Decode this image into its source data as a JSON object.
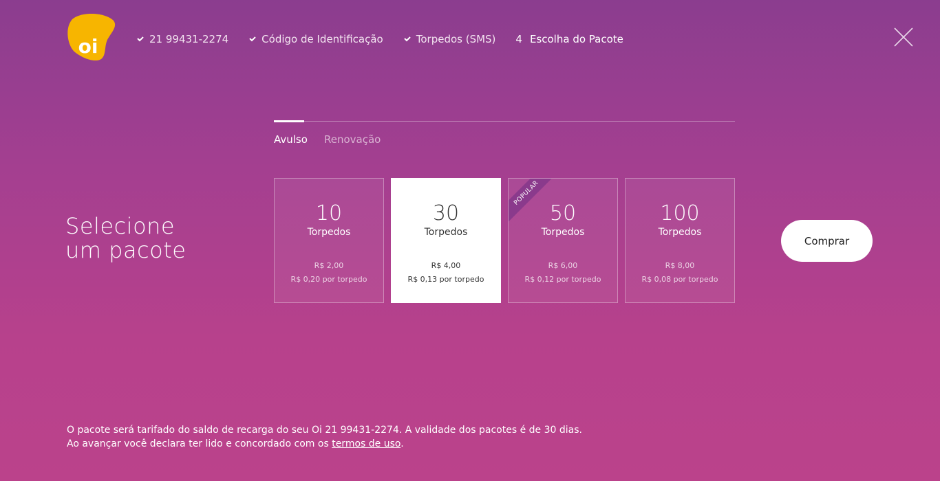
{
  "brand": {
    "logo_text": "oi",
    "logo_color": "#f7b500"
  },
  "steps": [
    {
      "label": "21 99431-2274",
      "done": true
    },
    {
      "label": "Código de Identificação",
      "done": true
    },
    {
      "label": "Torpedos (SMS)",
      "done": true
    },
    {
      "number": "4",
      "label": "Escolha do Pacote",
      "done": false
    }
  ],
  "tabs": [
    {
      "label": "Avulso",
      "active": true
    },
    {
      "label": "Renovação",
      "active": false
    }
  ],
  "headline": {
    "line1": "Selecione",
    "line2": "um pacote"
  },
  "packages": [
    {
      "qty": "10",
      "unit": "Torpedos",
      "price": "R$ 2,00",
      "per": "R$ 0,20 por torpedo",
      "selected": false
    },
    {
      "qty": "30",
      "unit": "Torpedos",
      "price": "R$ 4,00",
      "per": "R$ 0,13 por torpedo",
      "selected": true
    },
    {
      "qty": "50",
      "unit": "Torpedos",
      "price": "R$ 6,00",
      "per": "R$ 0,12 por torpedo",
      "selected": false,
      "badge": "Popular"
    },
    {
      "qty": "100",
      "unit": "Torpedos",
      "price": "R$ 8,00",
      "per": "R$ 0,08 por torpedo",
      "selected": false
    }
  ],
  "buy_button": "Comprar",
  "footer": {
    "line1": "O pacote será tarifado do saldo de recarga do seu Oi 21 99431-2274. A validade dos pacotes é de 30 dias.",
    "line2_prefix": "Ao avançar você declara ter lido e concordado com os ",
    "terms_link": "termos de uso",
    "line2_suffix": "."
  },
  "colors": {
    "bg_top": "#8b3d8f",
    "bg_bottom": "#bb428b",
    "ribbon": "#8a3a8c"
  }
}
